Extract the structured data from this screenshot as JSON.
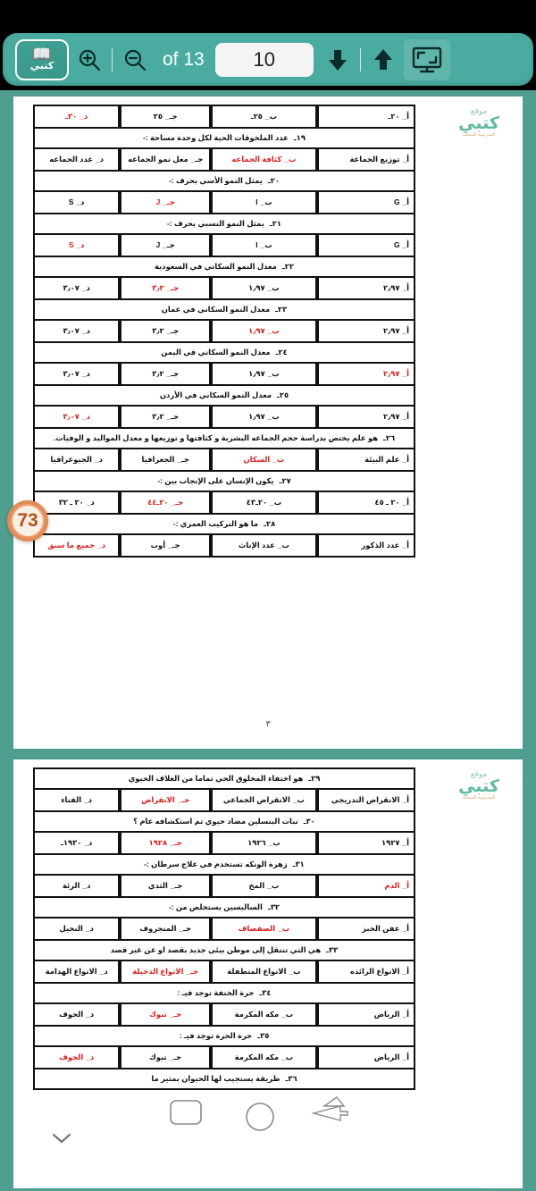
{
  "app": {
    "name": "كتبي",
    "logo_label": "كتبي"
  },
  "toolbar": {
    "logo_label": "كتبي",
    "zoom_in_icon": "zoom-in-icon",
    "zoom_out_icon": "zoom-out-icon",
    "of_label": "of 13",
    "total_pages": "13",
    "current_page": "10",
    "page_input_value": "10",
    "next_page_icon": "arrow-down-icon",
    "prev_page_icon": "arrow-up-icon",
    "fullscreen_icon": "screen-icon",
    "accent_color": "#4aaca0",
    "page_box_color": "#f4f4f4"
  },
  "overlays": {
    "badge_number": "73",
    "badge_color": "#e08c54",
    "scroll_chevron_icon": "chevron-down-icon"
  },
  "pages": [
    {
      "id": "page-1",
      "watermark": {
        "top": "موقع",
        "main": "كتبي",
        "sub": "المدرسية المملكة"
      },
      "footer_number": "٣",
      "rows": [
        {
          "type": "options",
          "options": [
            {
              "key": "أ_",
              "text": "٢٠ـ",
              "answer": false
            },
            {
              "key": "ب_",
              "text": "٢٥ـ",
              "answer": false
            },
            {
              "key": "جـ_",
              "text": "٢٥",
              "answer": false
            },
            {
              "key": "د_",
              "text": "٣٠ـ",
              "answer": true
            }
          ]
        },
        {
          "type": "stem",
          "num": "١٩ـ",
          "text": "عدد الملخوقات الحية لكل وحدة مساحة :-"
        },
        {
          "type": "options",
          "options": [
            {
              "key": "أ_",
              "text": "توزيع الجماعة",
              "answer": false
            },
            {
              "key": "ب_",
              "text": "كثافة الجماعه",
              "answer": true
            },
            {
              "key": "جـ_",
              "text": "معل نمو الجماعه",
              "answer": false
            },
            {
              "key": "د_",
              "text": "عدد الجماعه",
              "answer": false
            }
          ]
        },
        {
          "type": "stem",
          "num": "٢٠ـ",
          "text": "يمثل النمو الأسي بحرف :-"
        },
        {
          "type": "options",
          "options": [
            {
              "key": "أ_",
              "text": "G",
              "answer": false
            },
            {
              "key": "ب_",
              "text": "I",
              "answer": false
            },
            {
              "key": "جـ_",
              "text": "J",
              "answer": true
            },
            {
              "key": "د_",
              "text": "S",
              "answer": false
            }
          ]
        },
        {
          "type": "stem",
          "num": "٢١ـ",
          "text": "يمثل النمو النسبي بحرف :-"
        },
        {
          "type": "options",
          "options": [
            {
              "key": "أ_",
              "text": "G",
              "answer": false
            },
            {
              "key": "ب_",
              "text": "I",
              "answer": false
            },
            {
              "key": "جـ_",
              "text": "J",
              "answer": false
            },
            {
              "key": "د_",
              "text": "S",
              "answer": true
            }
          ]
        },
        {
          "type": "stem",
          "num": "٢٢ـ",
          "text": "معدل النمو السكاني في السعودية"
        },
        {
          "type": "options",
          "options": [
            {
              "key": "أ_",
              "text": "٢٫٩٧",
              "answer": false
            },
            {
              "key": "ب_",
              "text": "١٫٩٧",
              "answer": false
            },
            {
              "key": "جـ_",
              "text": "٣٫٢",
              "answer": true
            },
            {
              "key": "د_",
              "text": "٣٫٠٧",
              "answer": false
            }
          ]
        },
        {
          "type": "stem",
          "num": "٢٣ـ",
          "text": "معدل النمو السكاني في عمان"
        },
        {
          "type": "options",
          "options": [
            {
              "key": "أ_",
              "text": "٢٫٩٧",
              "answer": false
            },
            {
              "key": "ب_",
              "text": "١٫٩٧",
              "answer": true
            },
            {
              "key": "جـ_",
              "text": "٣٫٢",
              "answer": false
            },
            {
              "key": "د_",
              "text": "٣٫٠٧",
              "answer": false
            }
          ]
        },
        {
          "type": "stem",
          "num": "٢٤ـ",
          "text": "معدل النمو السكاني في اليمن"
        },
        {
          "type": "options",
          "options": [
            {
              "key": "أ_",
              "text": "٢٫٩٧",
              "answer": true
            },
            {
              "key": "ب_",
              "text": "١٫٩٧",
              "answer": false
            },
            {
              "key": "جـ_",
              "text": "٣٫٢",
              "answer": false
            },
            {
              "key": "د_",
              "text": "٣٫٠٧",
              "answer": false
            }
          ]
        },
        {
          "type": "stem",
          "num": "٢٥ـ",
          "text": "معدل النمو السكاني في الأردن"
        },
        {
          "type": "options",
          "options": [
            {
              "key": "أ_",
              "text": "٢٫٩٧",
              "answer": false
            },
            {
              "key": "ب_",
              "text": "١٫٩٧",
              "answer": false
            },
            {
              "key": "جـ_",
              "text": "٣٫٢",
              "answer": false
            },
            {
              "key": "د_",
              "text": "٣٫٠٧",
              "answer": true
            }
          ]
        },
        {
          "type": "stem",
          "num": "٢٦ـ",
          "text": "هو علم يختص بدراسة حجم الجماعه البشرية و كثافتها و توزيعها و معدل المواليد و الوفيات."
        },
        {
          "type": "options",
          "options": [
            {
              "key": "أ_",
              "text": "علم البيئة",
              "answer": false
            },
            {
              "key": "ب_",
              "text": "السكان",
              "answer": true
            },
            {
              "key": "جـ_",
              "text": "الجغرافيا",
              "answer": false
            },
            {
              "key": "د_",
              "text": "الجيوغرافيا",
              "answer": false
            }
          ]
        },
        {
          "type": "stem",
          "num": "٢٧ـ",
          "text": "يكون الإنسان على الإنجاب بين :-"
        },
        {
          "type": "options",
          "options": [
            {
              "key": "أ_",
              "text": "٢٠ ـ ٤٥",
              "answer": false
            },
            {
              "key": "ب_",
              "text": "٢٠ـ٤٣",
              "answer": false
            },
            {
              "key": "جـ_",
              "text": "٢٠ـ٤٤",
              "answer": true
            },
            {
              "key": "د_",
              "text": "٢٠ ـ ٣٢",
              "answer": false
            }
          ]
        },
        {
          "type": "stem",
          "num": "٢٨ـ",
          "text": "ما هو التركيب العمري :-"
        },
        {
          "type": "options",
          "options": [
            {
              "key": "أ_",
              "text": "عدد الذكور",
              "answer": false
            },
            {
              "key": "ب_",
              "text": "عدد الإناث",
              "answer": false
            },
            {
              "key": "جـ_",
              "text": "أوب",
              "answer": false
            },
            {
              "key": "د_",
              "text": "جميع ما سبق",
              "answer": true
            }
          ]
        }
      ]
    },
    {
      "id": "page-2",
      "watermark": {
        "top": "موقع",
        "main": "كتبي",
        "sub": "المدرسية المملكة"
      },
      "footer_number": "",
      "rows": [
        {
          "type": "stem",
          "num": "٢٩ـ",
          "text": "هو اختفاء المخلوق الحي تماما من الغلاف الحيوي"
        },
        {
          "type": "options",
          "options": [
            {
              "key": "أ_",
              "text": "الانقراض التدريجي",
              "answer": false
            },
            {
              "key": "ب_",
              "text": "الانقراض الجماعي",
              "answer": false
            },
            {
              "key": "جـ_",
              "text": "الانقراض",
              "answer": true
            },
            {
              "key": "د_",
              "text": "الفناء",
              "answer": false
            }
          ]
        },
        {
          "type": "stem",
          "num": "٣٠ـ",
          "text": "نبات البنسلين مضاد حيوي تم استكشافه عام ؟"
        },
        {
          "type": "options",
          "options": [
            {
              "key": "أ_",
              "text": "١٩٢٧",
              "answer": false
            },
            {
              "key": "ب_",
              "text": "١٩٢٦",
              "answer": false
            },
            {
              "key": "جـ_",
              "text": "١٩٢٨",
              "answer": true
            },
            {
              "key": "د_",
              "text": "١٩٣٠ـ",
              "answer": false
            }
          ]
        },
        {
          "type": "stem",
          "num": "٣١ـ",
          "text": "زهرة الونكه تستخدم في علاج سرطان :-"
        },
        {
          "type": "options",
          "options": [
            {
              "key": "أ_",
              "text": "الدم",
              "answer": true
            },
            {
              "key": "ب_",
              "text": "المخ",
              "answer": false
            },
            {
              "key": "جـ_",
              "text": "الثدي",
              "answer": false
            },
            {
              "key": "د_",
              "text": "الرئة",
              "answer": false
            }
          ]
        },
        {
          "type": "stem",
          "num": "٣٢ـ",
          "text": "الساليسين يستخلص من :-"
        },
        {
          "type": "options",
          "options": [
            {
              "key": "أ_",
              "text": "عفن الخبز",
              "answer": false
            },
            {
              "key": "ب_",
              "text": "الصفصاف",
              "answer": true
            },
            {
              "key": "جـ_",
              "text": "المنجروف",
              "answer": false
            },
            {
              "key": "د_",
              "text": "النخيل",
              "answer": false
            }
          ]
        },
        {
          "type": "stem",
          "num": "٣٣ـ",
          "text": "هي التي تنتقل إلى موطن بيئي جديد بقصد او عن غير قصد"
        },
        {
          "type": "options",
          "options": [
            {
              "key": "أ_",
              "text": "الانواع الرائده",
              "answer": false
            },
            {
              "key": "ب_",
              "text": "الانواع المتطفلة",
              "answer": false
            },
            {
              "key": "جـ_",
              "text": "الانواع الدخيلة",
              "answer": true
            },
            {
              "key": "د_",
              "text": "الانواع الهدامة",
              "answer": false
            }
          ]
        },
        {
          "type": "stem",
          "num": "٣٤ـ",
          "text": "حرة الخنفة توجد فيـ :"
        },
        {
          "type": "options",
          "options": [
            {
              "key": "أ_",
              "text": "الرياض",
              "answer": false
            },
            {
              "key": "ب_",
              "text": "مكه المكرمة",
              "answer": false
            },
            {
              "key": "جـ_",
              "text": "تبوك",
              "answer": true
            },
            {
              "key": "د_",
              "text": "الجوف",
              "answer": false
            }
          ]
        },
        {
          "type": "stem",
          "num": "٣٥ـ",
          "text": "حرة الحرة توجد فيـ :"
        },
        {
          "type": "options",
          "options": [
            {
              "key": "أ_",
              "text": "الرياض",
              "answer": false
            },
            {
              "key": "ب_",
              "text": "مكه المكرمة",
              "answer": false
            },
            {
              "key": "جـ_",
              "text": "تبوك",
              "answer": false
            },
            {
              "key": "د_",
              "text": "الجوف",
              "answer": true
            }
          ]
        },
        {
          "type": "stem",
          "num": "٣٦ـ",
          "text": "طريقة يستجيب لها الحيوان بمثير ما"
        }
      ]
    }
  ]
}
